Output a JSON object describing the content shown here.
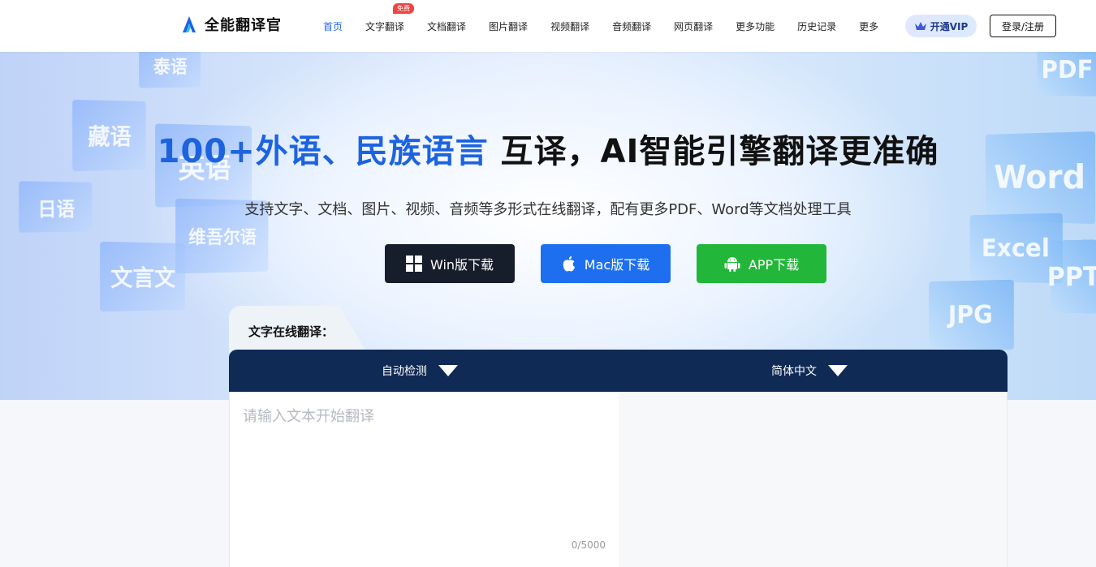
{
  "header": {
    "app_name": "全能翻译官",
    "nav": [
      {
        "label": "首页",
        "active": true
      },
      {
        "label": "文字翻译",
        "badge": "免费"
      },
      {
        "label": "文档翻译"
      },
      {
        "label": "图片翻译"
      },
      {
        "label": "视频翻译"
      },
      {
        "label": "音频翻译"
      },
      {
        "label": "网页翻译"
      },
      {
        "label": "更多功能"
      },
      {
        "label": "历史记录"
      },
      {
        "label": "更多"
      }
    ],
    "vip_label": "开通VIP",
    "login_label": "登录/注册"
  },
  "hero": {
    "title_blue": "100+外语、民族语言",
    "title_rest": " 互译，AI智能引擎翻译更准确",
    "subtitle": "支持文字、文档、图片、视频、音频等多形式在线翻译，配有更多PDF、Word等文档处理工具",
    "buttons": {
      "win": "Win版下载",
      "mac": "Mac版下载",
      "app": "APP下载"
    },
    "cards_left": [
      "泰语",
      "藏语",
      "英语",
      "日语",
      "维吾尔语",
      "文言文"
    ],
    "cards_right": [
      "PDF",
      "Word",
      "Excel",
      "PPT",
      "JPG"
    ]
  },
  "translator": {
    "tab_label": "文字在线翻译：",
    "source_lang": "自动检测",
    "target_lang": "简体中文",
    "input_placeholder": "请输入文本开始翻译",
    "char_count": "0/5000"
  },
  "colors": {
    "accent_blue": "#1d63e0",
    "lang_bar": "#102a56",
    "win_btn": "#161d2b",
    "mac_btn": "#1e6ff0",
    "app_btn": "#22b73a"
  }
}
